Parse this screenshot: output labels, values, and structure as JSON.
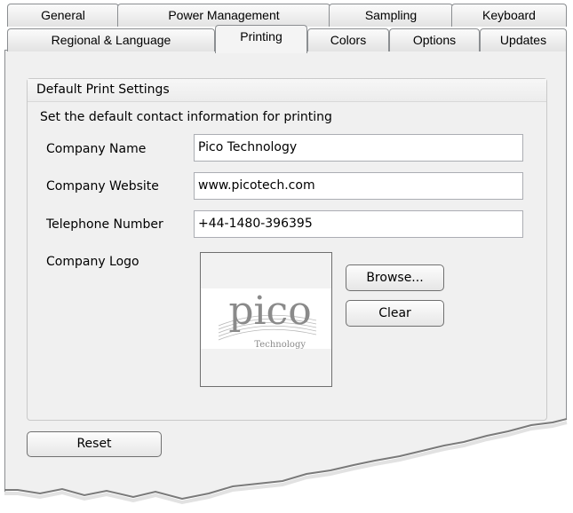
{
  "tabs_row1": [
    "General",
    "Power Management",
    "Sampling",
    "Keyboard"
  ],
  "tabs_row2": [
    "Regional & Language",
    "Printing",
    "Colors",
    "Options",
    "Updates"
  ],
  "selected_tab": "Printing",
  "group": {
    "title": "Default Print Settings",
    "intro": "Set the default contact information for printing"
  },
  "fields": {
    "company_name_label": "Company Name",
    "company_name_value": "Pico Technology",
    "company_website_label": "Company Website",
    "company_website_value": "www.picotech.com",
    "telephone_label": "Telephone Number",
    "telephone_value": "+44-1480-396395",
    "logo_label": "Company Logo"
  },
  "logo": {
    "wordmark": "pico",
    "subtext": "Technology"
  },
  "buttons": {
    "browse": "Browse...",
    "clear": "Clear",
    "reset": "Reset"
  },
  "colors": {
    "panel_bg": "#f0f0f0",
    "tab_border": "#8b8e91",
    "logo_text": "#8a8a8a"
  }
}
